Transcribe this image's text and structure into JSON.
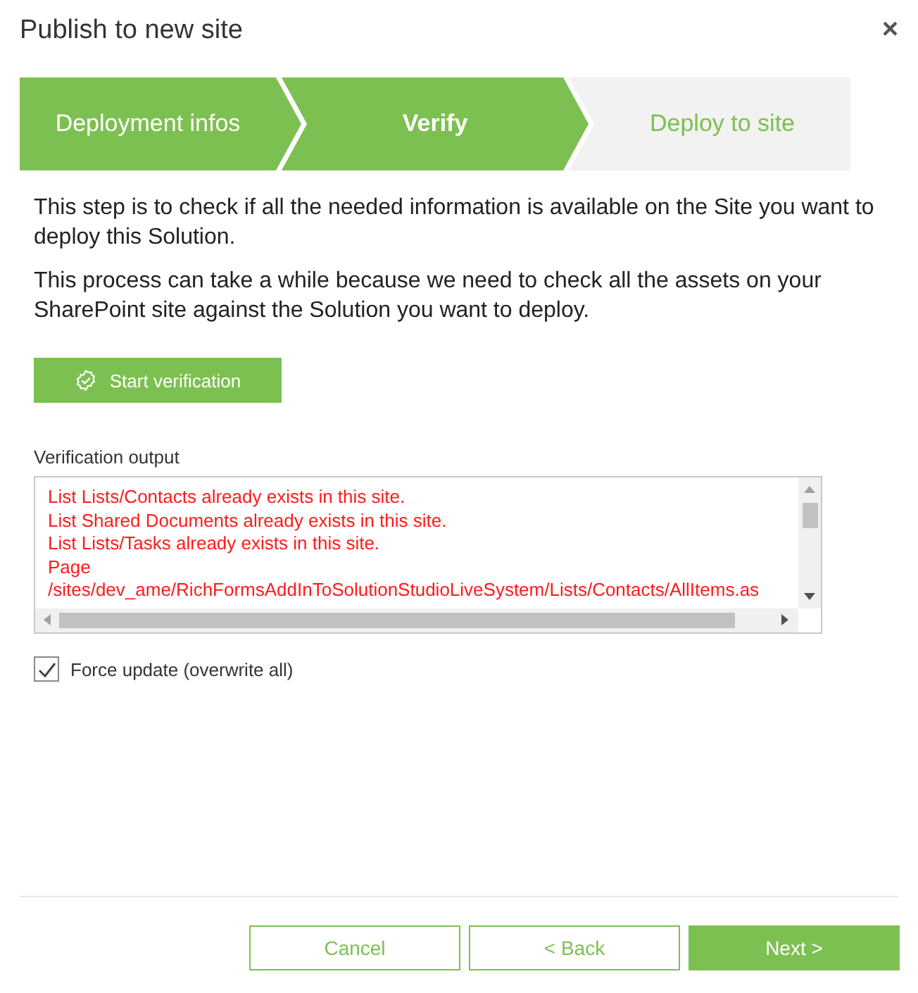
{
  "dialog": {
    "title": "Publish to new site",
    "close": "×"
  },
  "steps": [
    {
      "label": "Deployment infos",
      "completed": true,
      "selected": false
    },
    {
      "label": "Verify",
      "completed": false,
      "selected": true
    },
    {
      "label": "Deploy to site",
      "completed": false,
      "selected": false
    }
  ],
  "paragraphs": [
    "This step is to check if all the needed information is available on the Site you want to deploy this Solution.",
    "This process can take a while because we need to check all the assets on your SharePoint site against the Solution you want to deploy."
  ],
  "verify_button": {
    "label": "Start verification"
  },
  "output": {
    "label": "Verification output",
    "lines": [
      "List Lists/Contacts already exists in this site.",
      "List Shared Documents already exists in this site.",
      "List Lists/Tasks already exists in this site.",
      "Page",
      "/sites/dev_ame/RichFormsAddInToSolutionStudioLiveSystem/Lists/Contacts/AllItems.as"
    ]
  },
  "force_update": {
    "label": "Force update (overwrite all)",
    "checked": true
  },
  "buttons": [
    {
      "label": "Cancel",
      "kind": "secondary"
    },
    {
      "label": "< Back",
      "kind": "secondary"
    },
    {
      "label": "Next >",
      "kind": "primary"
    }
  ]
}
